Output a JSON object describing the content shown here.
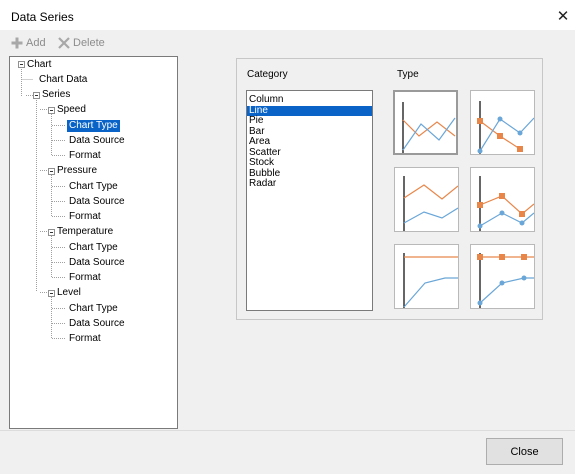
{
  "window": {
    "title": "Data Series",
    "close_glyph": "✕"
  },
  "toolbar": {
    "add_label": "Add",
    "delete_label": "Delete",
    "add_icon": "plus-icon",
    "delete_icon": "x-icon"
  },
  "tree": {
    "root": "Chart",
    "chart_data": "Chart Data",
    "series_label": "Series",
    "series": [
      {
        "name": "Speed",
        "children": [
          "Chart Type",
          "Data Source",
          "Format"
        ],
        "selected_child": "Chart Type"
      },
      {
        "name": "Pressure",
        "children": [
          "Chart Type",
          "Data Source",
          "Format"
        ]
      },
      {
        "name": "Temperature",
        "children": [
          "Chart Type",
          "Data Source",
          "Format"
        ]
      },
      {
        "name": "Level",
        "children": [
          "Chart Type",
          "Data Source",
          "Format"
        ]
      }
    ]
  },
  "chart_type": {
    "category_label": "Category",
    "type_label": "Type",
    "categories": [
      "Column",
      "Line",
      "Pie",
      "Bar",
      "Area",
      "Scatter",
      "Stock",
      "Bubble",
      "Radar"
    ],
    "selected_category": "Line",
    "thumbnails": [
      {
        "icon": "line-chart-thumbnail",
        "selected": true
      },
      {
        "icon": "line-markers-chart-thumbnail",
        "selected": false
      },
      {
        "icon": "stacked-line-chart-thumbnail",
        "selected": false
      },
      {
        "icon": "stacked-line-markers-chart-thumbnail",
        "selected": false
      },
      {
        "icon": "step-line-chart-thumbnail",
        "selected": false
      },
      {
        "icon": "step-line-markers-chart-thumbnail",
        "selected": false
      }
    ],
    "colors": {
      "orange": "#e8864a",
      "blue": "#6aa6d8",
      "selection": "#0a64c8"
    }
  },
  "footer": {
    "close_label": "Close"
  }
}
